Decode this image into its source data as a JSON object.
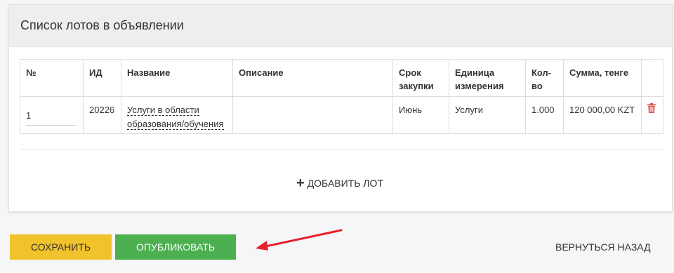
{
  "panel": {
    "title": "Список лотов в объявлении"
  },
  "table": {
    "headers": {
      "num": "№",
      "id": "ИД",
      "name": "Название",
      "description": "Описание",
      "term_line1": "Срок",
      "term_line2": "закупки",
      "unit_line1": "Единица",
      "unit_line2": "измерения",
      "qty_line1": "Кол-",
      "qty_line2": "во",
      "sum": "Сумма, тенге"
    },
    "rows": [
      {
        "num": "1",
        "id": "20226",
        "name_line1": "Услуги в области",
        "name_line2": "образования/обучения",
        "description": "",
        "term": "Июнь",
        "unit": "Услуги",
        "qty": "1.000",
        "sum": "120 000,00 KZT"
      }
    ]
  },
  "add_lot_label": "ДОБАВИТЬ ЛОТ",
  "buttons": {
    "save": "СОХРАНИТЬ",
    "publish": "ОПУБЛИКОВАТЬ",
    "back": "ВЕРНУТЬСЯ НАЗАД"
  },
  "colors": {
    "save_bg": "#f0c22b",
    "publish_bg": "#4caf50",
    "trash": "#d9534f",
    "arrow": "#e8202a"
  },
  "icons": {
    "trash": "trash-icon",
    "plus": "plus-icon",
    "arrow": "arrow-annotation"
  }
}
